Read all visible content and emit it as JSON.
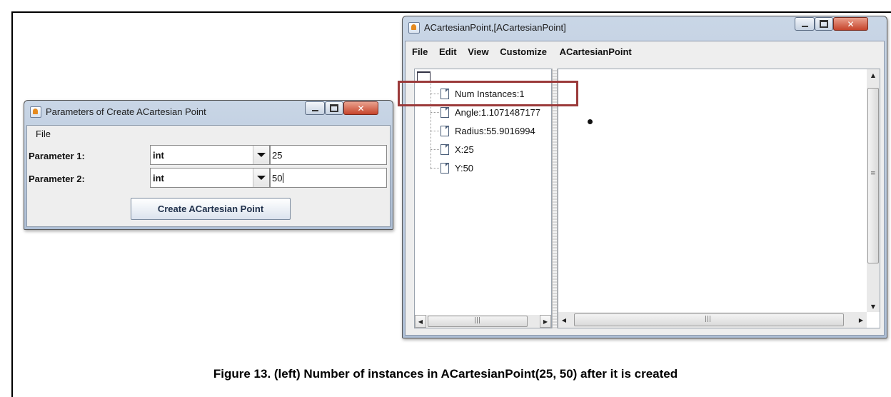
{
  "left_window": {
    "title": "Parameters of Create  ACartesian Point",
    "menu": [
      "File"
    ],
    "params": [
      {
        "label": "Parameter 1:",
        "type": "int",
        "value": "25"
      },
      {
        "label": "Parameter 2:",
        "type": "int",
        "value": "50"
      }
    ],
    "create_button": "Create  ACartesian Point"
  },
  "right_window": {
    "title": "ACartesianPoint,[ACartesianPoint]",
    "menu": [
      "File",
      "Edit",
      "View",
      "Customize",
      "ACartesianPoint"
    ],
    "tree_items": [
      "Num Instances:1",
      "Angle:1.1071487177",
      "Radius:55.9016994",
      "X:25",
      "Y:50"
    ],
    "highlighted_item": "Num Instances:1",
    "highlight_color": "#9b3a3a",
    "point_value": {
      "x": 25,
      "y": 50
    }
  },
  "caption": "Figure 13. (left) Number of instances in ACartesianPoint(25, 50) after it is created"
}
